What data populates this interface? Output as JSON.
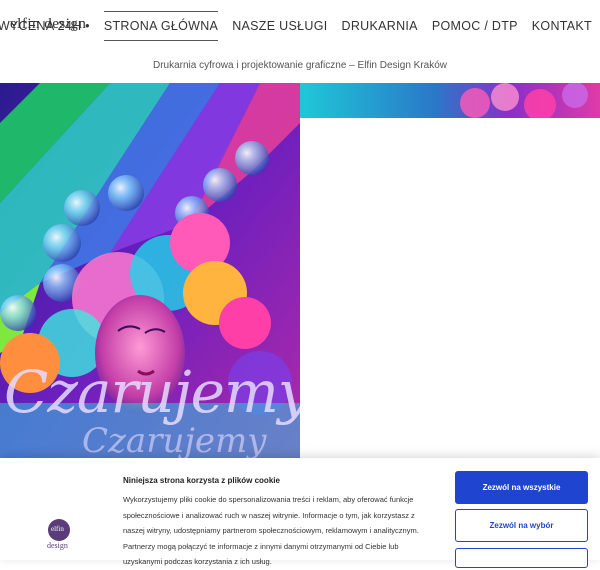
{
  "brand": {
    "logo": "elfin design"
  },
  "nav": {
    "items": [
      "• WYCENA 24H •",
      "STRONA GŁÓWNA",
      "NASZE USŁUGI",
      "DRUKARNIA",
      "POMOC / DTP",
      "KONTAKT"
    ],
    "active_index": 1
  },
  "tagline": "Drukarnia cyfrowa i projektowanie graficzne – Elfin Design Kraków",
  "hero": {
    "script_text": "Czarujemy",
    "script_shadow": "Czarujemy"
  },
  "cookie": {
    "logo_text_top": "elfin",
    "logo_text_bottom": "design",
    "title": "Niniejsza strona korzysta z plików cookie",
    "body": "Wykorzystujemy pliki cookie do spersonalizowania treści i reklam, aby oferować funkcje społecznościowe i analizować ruch w naszej witrynie. Informacje o tym, jak korzystasz z naszej witryny, udostępniamy partnerom społecznościowym, reklamowym i analitycznym. Partnerzy mogą połączyć te informacje z innymi danymi otrzymanymi od Ciebie lub uzyskanymi podczas korzystania z ich usług.",
    "allow_all": "Zezwól na wszystkie",
    "allow_selection": "Zezwól na wybór"
  },
  "colors": {
    "accent": "#1e44d0"
  }
}
